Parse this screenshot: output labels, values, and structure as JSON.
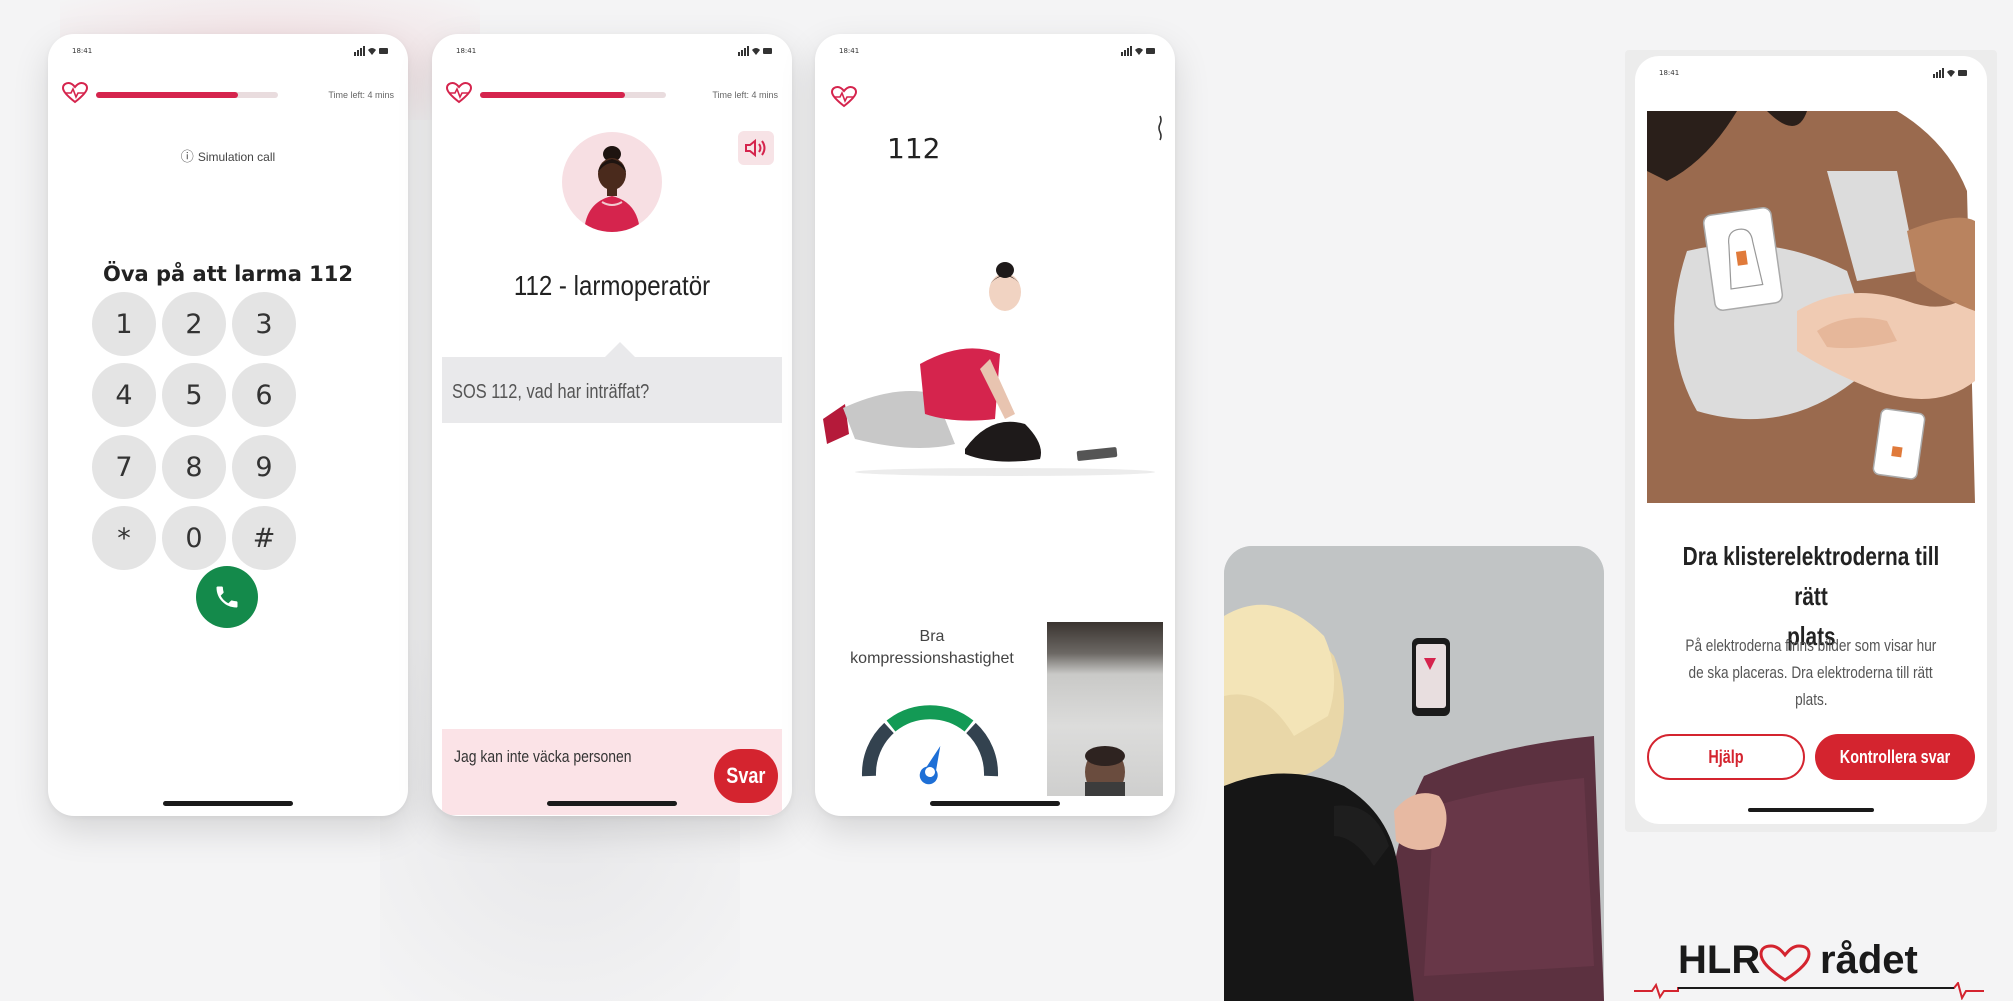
{
  "status_bar": {
    "time": "18:41"
  },
  "phone1": {
    "time_left": "Time left: 4 mins",
    "progress": 0.78,
    "simulation_note": "Simulation call",
    "title": "Öva på att larma 112",
    "keys": [
      "1",
      "2",
      "3",
      "4",
      "5",
      "6",
      "7",
      "8",
      "9",
      "*",
      "0",
      "#"
    ],
    "icons": {
      "call": "phone-icon",
      "info": "info-icon",
      "logo": "heart-logo-icon"
    },
    "colors": {
      "accent": "#d5244d",
      "call_button": "#148a4b"
    }
  },
  "phone2": {
    "time_left": "Time left: 4 mins",
    "progress": 0.78,
    "operator_title": "112 - larmoperatör",
    "operator_message": "SOS 112, vad har inträffat?",
    "reply_text": "Jag kan inte väcka personen",
    "reply_button": "Svar",
    "icons": {
      "speaker": "speaker-icon",
      "avatar": "operator-avatar-icon"
    },
    "colors": {
      "reply_button": "#d4242f",
      "reply_bg": "#fbe3e7"
    }
  },
  "phone3": {
    "number": "112",
    "speed_label_line1": "Bra",
    "speed_label_line2": "kompressionshastighet",
    "gauge_level": 0.62,
    "icons": {
      "menu": "more-vertical-icon",
      "gauge": "speedometer-icon"
    }
  },
  "phone4": {
    "title_line1": "Dra klisterelektroderna till rätt",
    "title_line2": "plats",
    "desc_line1": "På elektroderna finns bilder som visar hur",
    "desc_line2": "de ska placeras. Dra elektroderna till rätt",
    "desc_line3": "plats.",
    "help_button": "Hjälp",
    "check_button": "Kontrollera svar",
    "colors": {
      "primary": "#d4242f"
    }
  },
  "brand": {
    "left": "HLR",
    "right": "rådet",
    "icon": "heart-ecg-logo-icon",
    "color": "#d4242f"
  }
}
